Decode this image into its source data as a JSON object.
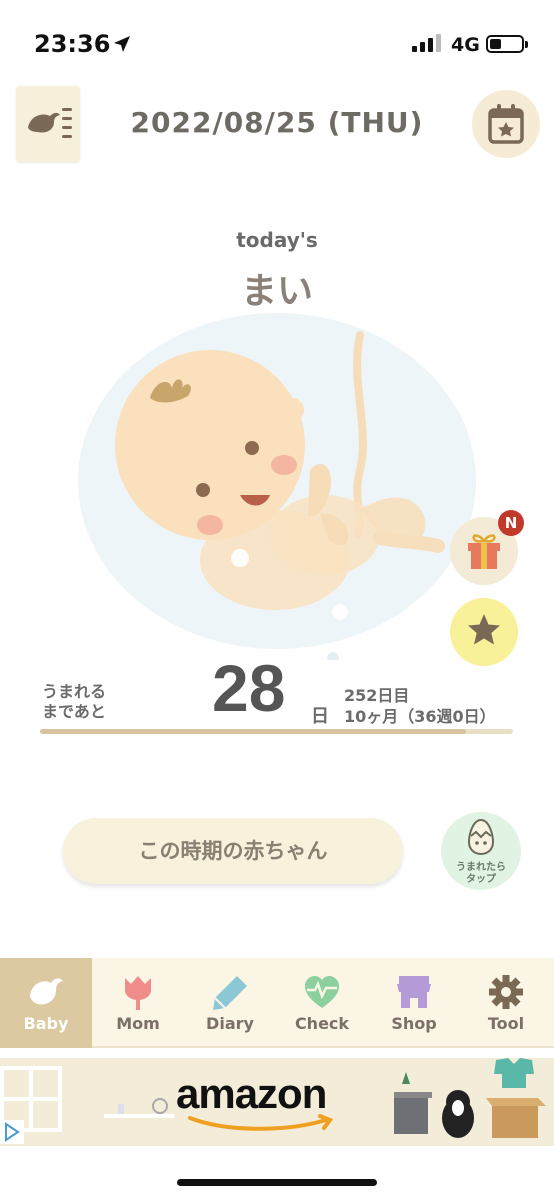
{
  "status_bar": {
    "time": "23:36",
    "network": "4G",
    "battery_level": 0.35
  },
  "header": {
    "date": "2022/08/25 (THU)"
  },
  "greeting": {
    "todays": "today's",
    "baby_name": "まい"
  },
  "buttons": {
    "gift_badge": "N"
  },
  "countdown": {
    "until_line1": "うまれる",
    "until_line2": "まであと",
    "days_remaining": "28",
    "days_unit": "日",
    "day_count": "252日目",
    "week_count": "10ヶ月（36週0日）",
    "progress_fraction": 0.9
  },
  "baby_this_period_button": "この時期の赤ちゃん",
  "born_button": {
    "line1": "うまれたら",
    "line2": "タップ"
  },
  "tabs": [
    {
      "label": "Baby",
      "icon": "bird-icon",
      "active": true
    },
    {
      "label": "Mom",
      "icon": "tulip-icon",
      "active": false
    },
    {
      "label": "Diary",
      "icon": "pencil-icon",
      "active": false
    },
    {
      "label": "Check",
      "icon": "heart-pulse-icon",
      "active": false
    },
    {
      "label": "Shop",
      "icon": "shop-icon",
      "active": false
    },
    {
      "label": "Tool",
      "icon": "gear-icon",
      "active": false
    }
  ],
  "ad": {
    "brand": "amazon"
  },
  "colors": {
    "tab_active_bg": "#dcc8a1",
    "tab_bar_bg": "#fbf5e5",
    "accent_beige": "#f6ecd6",
    "star_yellow": "#f8f19a",
    "badge_red": "#c0392b"
  }
}
